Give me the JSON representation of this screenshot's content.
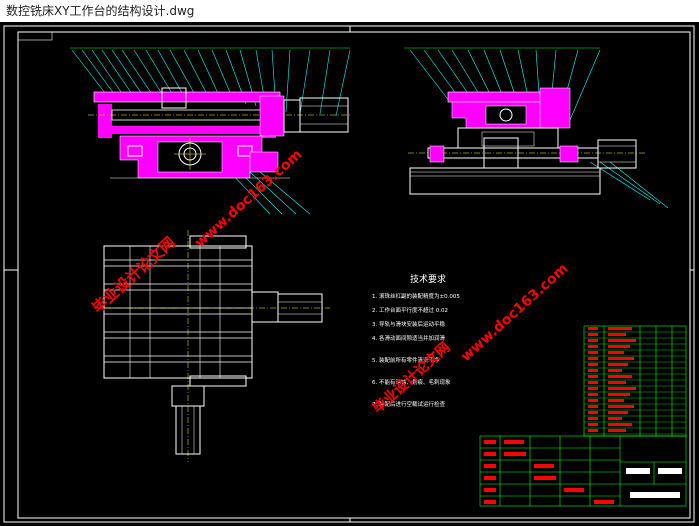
{
  "window": {
    "title": "数控铣床XY工作台的结构设计.dwg"
  },
  "drawing": {
    "tech_title": "技术要求",
    "tech_notes": [
      "1. 滚珠丝杠副的装配精度为±0.005",
      "2. 工作台面平行度不超过 0.02",
      "3. 导轨与滑块安装后运动平稳",
      "4. 各滑动面间隙适当并加润滑",
      "5. 装配前所有零件清洗干净",
      "6. 不能有锈蚀、划痕、毛刺现象",
      "7. 装配后进行空载试运行检查"
    ],
    "watermarks": [
      "毕业设计论文网",
      "www.doc163.com",
      "毕业设计论文网",
      "www.doc163.com"
    ]
  },
  "colors": {
    "background": "#000000",
    "titlebar": "#ffffff",
    "frame": "#ffffff",
    "outline": "#ffffff",
    "part_fill": "#ff00ff",
    "center_line": "#ffff00",
    "dimension": "#00ff00",
    "leader": "#00ffff",
    "table": "#00ff00",
    "table_text": "#ff0000",
    "watermark": "#ff0000"
  }
}
